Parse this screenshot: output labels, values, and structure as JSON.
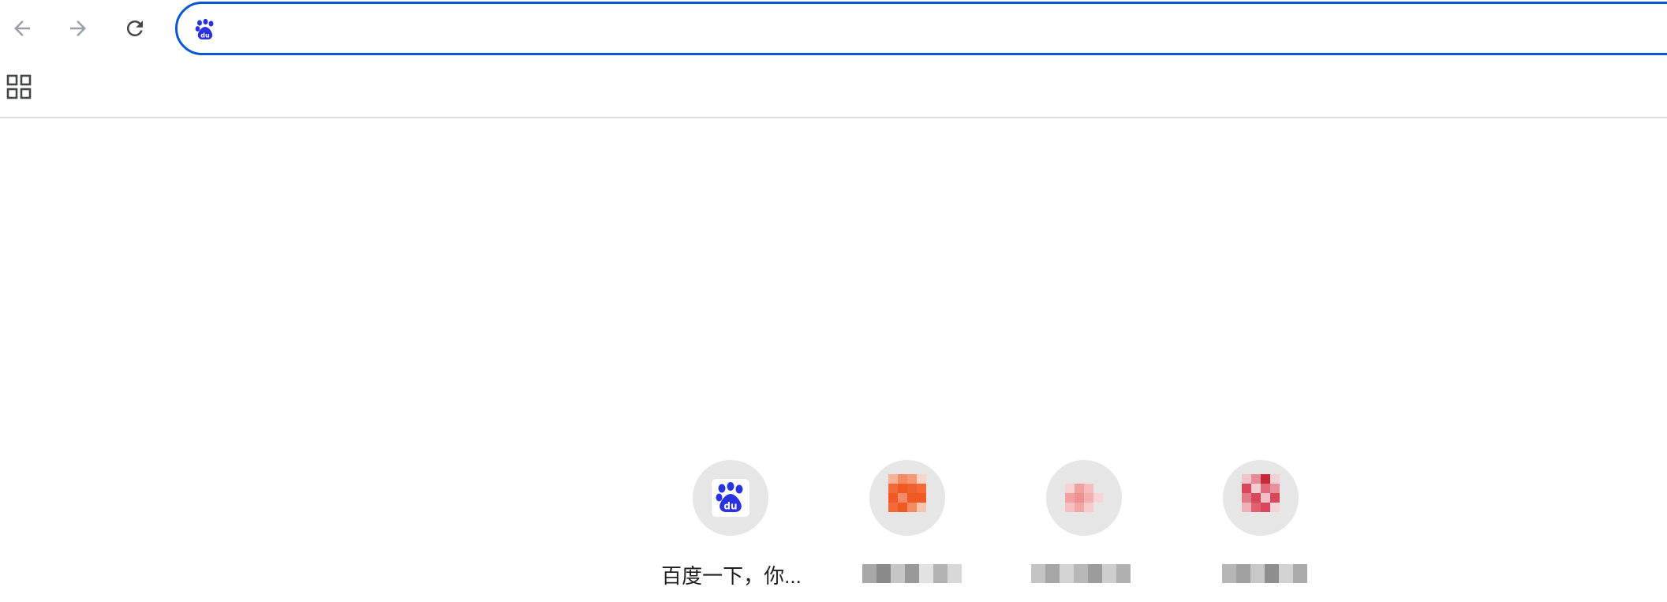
{
  "toolbar": {
    "back_icon": "arrow-left-icon",
    "forward_icon": "arrow-right-icon",
    "reload_icon": "reload-icon"
  },
  "omnibox": {
    "site_icon": "baidu-paw-icon",
    "value": "",
    "accent_color": "#0b57d0"
  },
  "bookmarks_bar": {
    "apps_icon": "apps-grid-icon"
  },
  "shortcuts": [
    {
      "label": "百度一下，你...",
      "icon": "baidu-paw-icon",
      "icon_color": "#2932e1"
    },
    {
      "label": "",
      "icon": "pixelated-orange-icon",
      "icon_color": "#f05a22"
    },
    {
      "label": "",
      "icon": "pixelated-pink-icon",
      "icon_color": "#f2a0a0"
    },
    {
      "label": "",
      "icon": "pixelated-red-icon",
      "icon_color": "#d9475a"
    }
  ]
}
